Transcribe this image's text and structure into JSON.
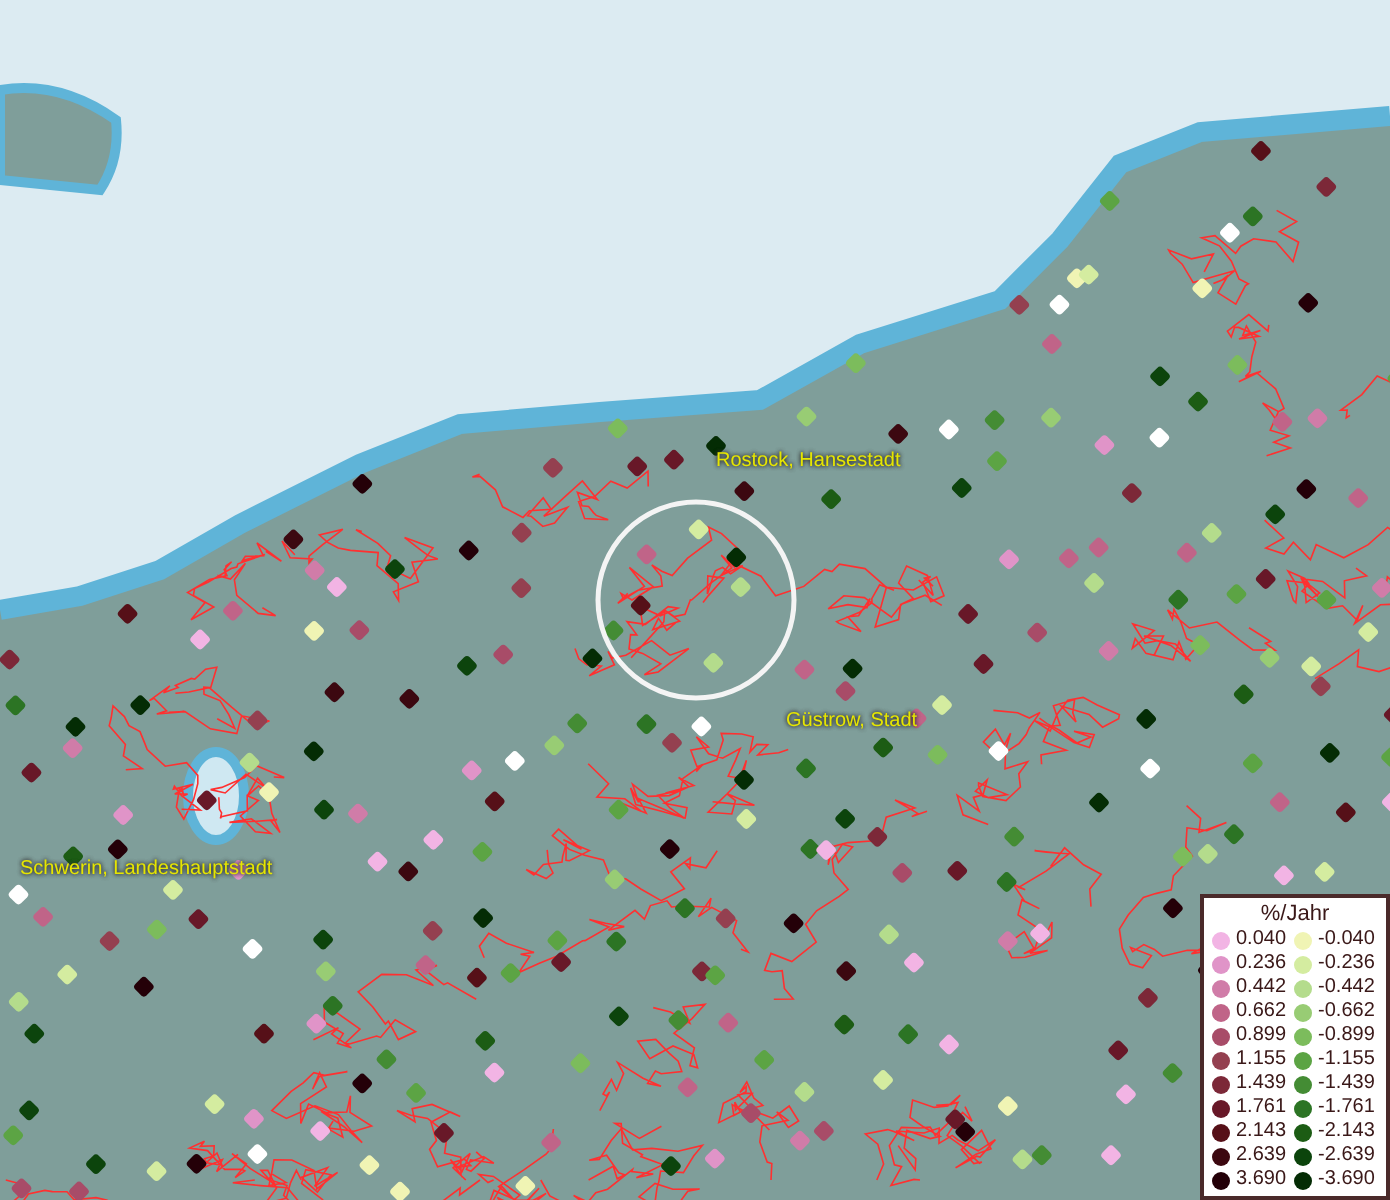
{
  "map": {
    "places": [
      {
        "name": "Rostock, Hansestadt"
      },
      {
        "name": "Güstrow, Stadt"
      },
      {
        "name": "Schwerin, Landeshauptstadt"
      }
    ]
  },
  "legend": {
    "title": "%/Jahr",
    "positive": [
      {
        "label": "0.040",
        "color": "#f2b4e4"
      },
      {
        "label": "0.236",
        "color": "#e094c8"
      },
      {
        "label": "0.442",
        "color": "#d07ca8"
      },
      {
        "label": "0.662",
        "color": "#c06488"
      },
      {
        "label": "0.899",
        "color": "#a84c68"
      },
      {
        "label": "1.155",
        "color": "#944050"
      },
      {
        "label": "1.439",
        "color": "#7c2838"
      },
      {
        "label": "1.761",
        "color": "#681828"
      },
      {
        "label": "2.143",
        "color": "#561018"
      },
      {
        "label": "2.639",
        "color": "#3c0810"
      },
      {
        "label": "3.690",
        "color": "#240008"
      }
    ],
    "negative": [
      {
        "label": "-0.040",
        "color": "#f0f4b4"
      },
      {
        "label": "-0.236",
        "color": "#d4eca0"
      },
      {
        "label": "-0.442",
        "color": "#b4dc8c"
      },
      {
        "label": "-0.662",
        "color": "#98cc74"
      },
      {
        "label": "-0.899",
        "color": "#7cbc5c"
      },
      {
        "label": "-1.155",
        "color": "#5ca444"
      },
      {
        "label": "-1.439",
        "color": "#448c34"
      },
      {
        "label": "-1.761",
        "color": "#2c7424"
      },
      {
        "label": "-2.143",
        "color": "#1c5c14"
      },
      {
        "label": "-2.639",
        "color": "#0c440c"
      },
      {
        "label": "-3.690",
        "color": "#042c04"
      }
    ]
  }
}
